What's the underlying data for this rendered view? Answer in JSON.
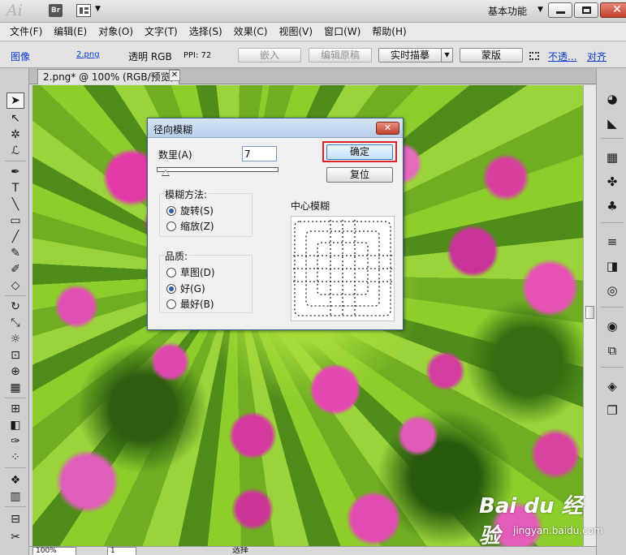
{
  "titlebar": {
    "app_logo": "Ai",
    "bridge": "Br",
    "workspace": "基本功能"
  },
  "menu": [
    "文件(F)",
    "编辑(E)",
    "对象(O)",
    "文字(T)",
    "选择(S)",
    "效果(C)",
    "视图(V)",
    "窗口(W)",
    "帮助(H)"
  ],
  "control": {
    "object_type": "图像",
    "file_name": "2.png",
    "color_mode": "透明 RGB",
    "ppi": "PPI: 72",
    "embed": "嵌入",
    "edit_original": "编辑原稿",
    "live_trace": "实时描摹",
    "mask": "蒙版",
    "opacity": "不透...",
    "align": "对齐"
  },
  "document": {
    "tab_label": "2.png* @ 100% (RGB/预览)",
    "zoom": "100%",
    "page": "1",
    "status": "选择"
  },
  "dialog": {
    "title": "径向模糊",
    "amount_label": "数里(A)",
    "amount_value": "7",
    "amount_fraction": 0.07,
    "ok": "确定",
    "reset": "复位",
    "method_title": "模糊方法:",
    "method_options": [
      "旋转(S)",
      "缩放(Z)"
    ],
    "method_selected": 0,
    "quality_title": "品质:",
    "quality_options": [
      "草图(D)",
      "好(G)",
      "最好(B)"
    ],
    "quality_selected": 1,
    "center_label": "中心模糊"
  },
  "icons": {
    "window_close": "✕",
    "tab_close": "✕",
    "dropdown": "▼"
  },
  "colors": {
    "highlight": "#e0202a",
    "link": "#0a3ad0"
  },
  "watermark": {
    "main": "Bai du 经验",
    "sub": "jingyan.baidu.com"
  }
}
